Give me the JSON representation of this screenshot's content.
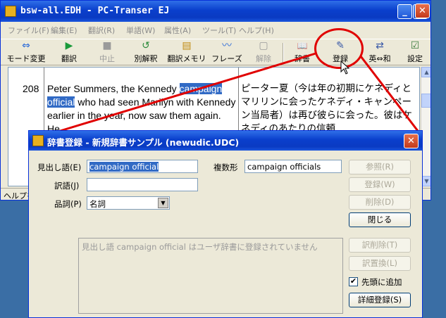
{
  "window": {
    "title": "bsw-all.EDH - PC-Transer EJ",
    "minimize": "_",
    "maximize": "□",
    "close": "✕"
  },
  "menubar": [
    {
      "label": "ファイル(F)"
    },
    {
      "label": "編集(E)"
    },
    {
      "label": "翻訳(R)"
    },
    {
      "label": "単語(W)"
    },
    {
      "label": "属性(A)"
    },
    {
      "label": "ツール(T)"
    },
    {
      "label": "ヘルプ(H)"
    }
  ],
  "toolbar": [
    {
      "label": "モード変更",
      "icon": "mode-icon",
      "glyph": "⇔"
    },
    {
      "label": "翻訳",
      "icon": "translate-icon",
      "glyph": "▶"
    },
    {
      "label": "中止",
      "icon": "stop-icon",
      "glyph": "■"
    },
    {
      "label": "別解釈",
      "icon": "reinterpret-icon",
      "glyph": "↺"
    },
    {
      "label": "翻訳メモリ",
      "icon": "memory-icon",
      "glyph": "▤"
    },
    {
      "label": "フレーズ",
      "icon": "phrase-icon",
      "glyph": "〰"
    },
    {
      "label": "解除",
      "icon": "release-icon",
      "glyph": "▢"
    },
    {
      "label": "辞書",
      "icon": "dictionary-icon",
      "glyph": "📖"
    },
    {
      "label": "登録",
      "icon": "register-icon",
      "glyph": "✎"
    },
    {
      "label": "英⇔和",
      "icon": "lang-swap-icon",
      "glyph": "⇄"
    },
    {
      "label": "設定",
      "icon": "settings-icon",
      "glyph": "☑"
    }
  ],
  "document": {
    "sentence_number": "208",
    "source_before": "Peter Summers, the Kennedy",
    "source_highlight": "campaign official",
    "source_after": " who had seen Marilyn with Kennedy earlier in the year, now saw them again. He",
    "target_text": "ピーター夏（今は年の初期にケネディとマリリンに会ったケネディ・キャンペーン当局者）は再び彼らに会った。彼はケネディのあたりの信頼"
  },
  "statusbar": {
    "text": "ヘルプを"
  },
  "dialog": {
    "title": "辞書登録 - 新規辞書サンプル (newudic.UDC)",
    "close": "✕",
    "headword_label": "見出し語(E)",
    "headword_value": "campaign official",
    "plural_label": "複数形",
    "plural_value": "campaign officials",
    "translation_label": "訳語(J)",
    "translation_value": "",
    "pos_label": "品詞(P)",
    "pos_value": "名詞",
    "message": "見出し語 campaign official はユーザ辞書に登録されていません",
    "buttons": {
      "browse": "参照(R)",
      "register": "登録(W)",
      "delete": "削除(D)",
      "close": "閉じる",
      "delete_translation": "訳削除(T)",
      "replace_translation": "訳置換(L)",
      "detail_register": "詳細登録(S)"
    },
    "prepend_checkbox_label": "先頭に追加",
    "prepend_checked": "✔"
  }
}
